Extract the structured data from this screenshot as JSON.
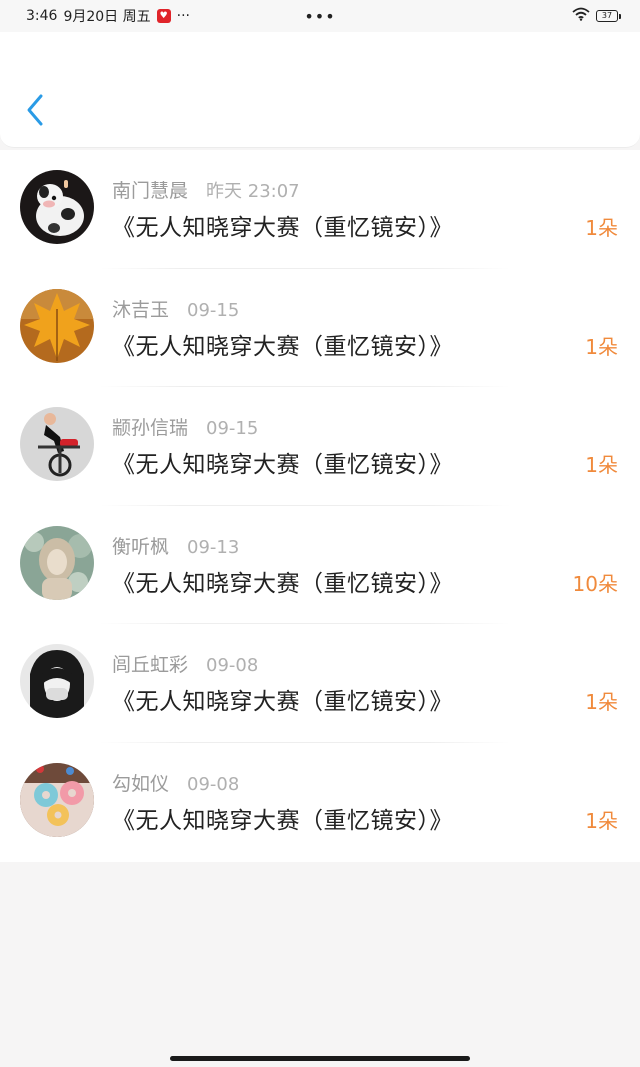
{
  "status_bar": {
    "time": "3:46",
    "date": "9月20日 周五",
    "notification_app": "app-notification-icon",
    "more_dots": "···",
    "center_dots": "•••",
    "battery_level": "37"
  },
  "header": {
    "back_icon": "chevron-left-icon",
    "accent_color": "#2a9be6"
  },
  "items": [
    {
      "name": "南门慧晨",
      "time": "昨天 23:07",
      "title": "《无人知晓穿大赛（重忆镜安）》",
      "count": "1朵",
      "avatar": "cow-avatar"
    },
    {
      "name": "沐吉玉",
      "time": "09-15",
      "title": "《无人知晓穿大赛（重忆镜安）》",
      "count": "1朵",
      "avatar": "maple-leaf-avatar"
    },
    {
      "name": "颛孙信瑞",
      "time": "09-15",
      "title": "《无人知晓穿大赛（重忆镜安）》",
      "count": "1朵",
      "avatar": "cyclist-avatar"
    },
    {
      "name": "衡听枫",
      "time": "09-13",
      "title": "《无人知晓穿大赛（重忆镜安）》",
      "count": "10朵",
      "avatar": "portrait-avatar"
    },
    {
      "name": "闾丘虹彩",
      "time": "09-08",
      "title": "《无人知晓穿大赛（重忆镜安）》",
      "count": "1朵",
      "avatar": "bw-portrait-avatar"
    },
    {
      "name": "勾如仪",
      "time": "09-08",
      "title": "《无人知晓穿大赛（重忆镜安）》",
      "count": "1朵",
      "avatar": "donuts-avatar"
    }
  ],
  "colors": {
    "count": "#f08a3c",
    "name": "#9b9b9b",
    "title": "#222222",
    "background": "#f6f5f5"
  }
}
